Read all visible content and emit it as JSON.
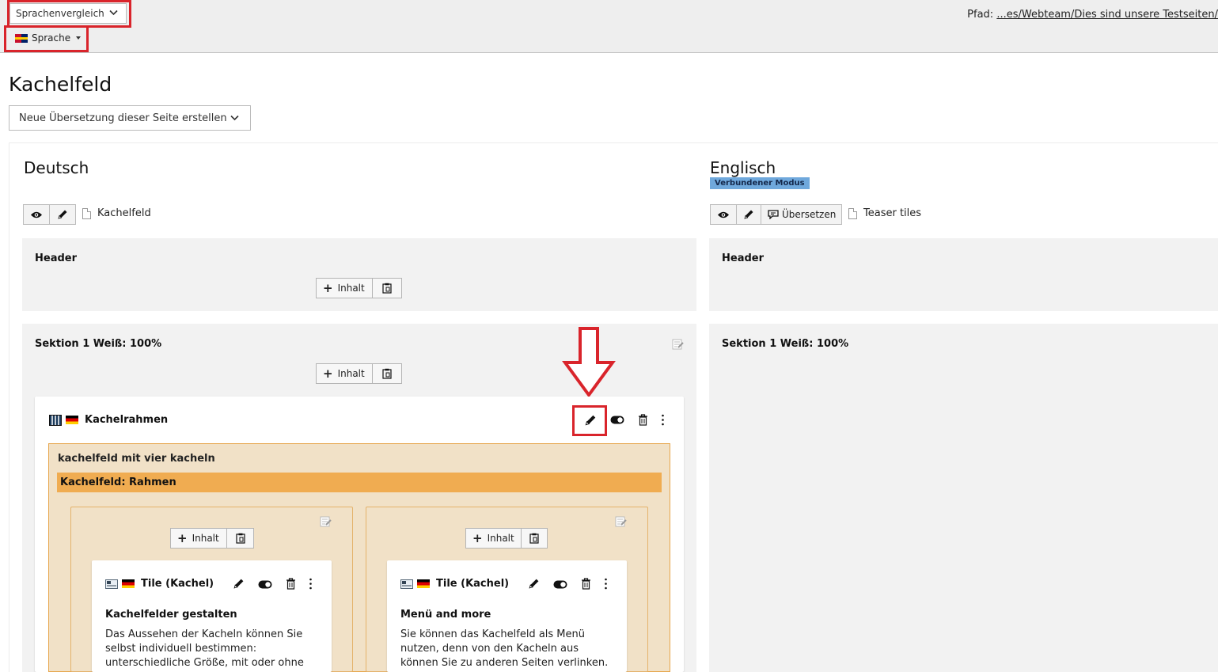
{
  "topbar": {
    "view_select": "Sprachenvergleich",
    "language_button": "Sprache",
    "path_label": "Pfad:",
    "path_value": "...es/Webteam/Dies sind unsere Testseiten/"
  },
  "page": {
    "title": "Kachelfeld",
    "translation_select": "Neue Übersetzung dieser Seite erstellen"
  },
  "columns": {
    "left": {
      "title": "Deutsch",
      "page_name": "Kachelfeld"
    },
    "right": {
      "title": "Englisch",
      "badge": "Verbundener Modus",
      "translate_label": "Übersetzen",
      "page_name": "Teaser tiles"
    }
  },
  "sections": {
    "header": "Header",
    "sektion1": "Sektion 1 Weiß: 100%",
    "add_content": "Inhalt"
  },
  "element": {
    "title": "Kachelrahmen",
    "box_title": "kachelfeld mit vier kacheln",
    "box_header": "Kachelfeld: Rahmen"
  },
  "tiles": [
    {
      "title": "Tile (Kachel)",
      "heading": "Kachelfelder gestalten",
      "lines": [
        "Das Aussehen der Kacheln können Sie",
        "selbst individuell bestimmen:",
        "unterschiedliche Größe, mit oder ohne"
      ]
    },
    {
      "title": "Tile (Kachel)",
      "heading": "Menü and more",
      "lines": [
        "Sie können das Kachelfeld als Menü",
        "nutzen, denn von den Kacheln aus",
        "können Sie zu anderen Seiten verlinken."
      ]
    }
  ],
  "colors": {
    "highlight_red": "#d9242b",
    "badge_blue": "#6fa8dc",
    "orange_header": "#f0ac51",
    "orange_bg": "#f1e1c7"
  }
}
